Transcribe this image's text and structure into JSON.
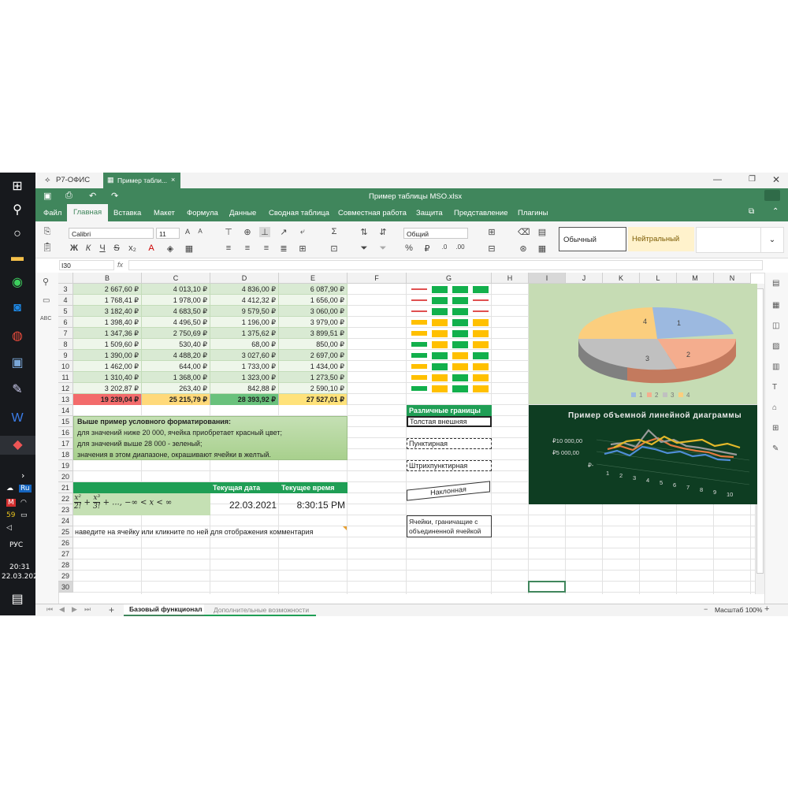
{
  "taskbar": {
    "lang": "РУС",
    "time": "20:31",
    "date": "22.03.2021",
    "tray_ru": "Ru",
    "tray_m": "M",
    "tray_59": "59"
  },
  "app": {
    "brand": "Р7-ОФИС",
    "tab_title": "Пример табли...",
    "window_title": "Пример таблицы MSO.xlsx"
  },
  "menu": [
    "Файл",
    "Главная",
    "Вставка",
    "Макет",
    "Формула",
    "Данные",
    "Сводная таблица",
    "Совместная работа",
    "Защита",
    "Представление",
    "Плагины"
  ],
  "toolbar": {
    "font": "Calibri",
    "size": "11",
    "format": "Общий",
    "style_normal": "Обычный",
    "style_neutral": "Нейтральный",
    "bold": "Ж",
    "italic": "К",
    "underline": "Ч",
    "strike": "S"
  },
  "formula": {
    "cell_ref": "I30",
    "fx": "fx"
  },
  "columns": [
    "B",
    "C",
    "D",
    "E",
    "F",
    "G",
    "H",
    "I",
    "J",
    "K",
    "L",
    "M",
    "N"
  ],
  "rows": [
    "3",
    "4",
    "5",
    "6",
    "7",
    "8",
    "9",
    "10",
    "11",
    "12",
    "13",
    "14",
    "15",
    "16",
    "17",
    "18",
    "19",
    "20",
    "21",
    "22",
    "23",
    "24",
    "25",
    "26",
    "27",
    "28",
    "29",
    "30"
  ],
  "table": [
    [
      "2 667,60 ₽",
      "4 013,10 ₽",
      "4 836,00 ₽",
      "6 087,90 ₽"
    ],
    [
      "1 768,41 ₽",
      "1 978,00 ₽",
      "4 412,32 ₽",
      "1 656,00 ₽"
    ],
    [
      "3 182,40 ₽",
      "4 683,50 ₽",
      "9 579,50 ₽",
      "3 060,00 ₽"
    ],
    [
      "1 398,40 ₽",
      "4 496,50 ₽",
      "1 196,00 ₽",
      "3 979,00 ₽"
    ],
    [
      "1 347,36 ₽",
      "2 750,69 ₽",
      "1 375,62 ₽",
      "3 899,51 ₽"
    ],
    [
      "1 509,60 ₽",
      "530,40 ₽",
      "68,00 ₽",
      "850,00 ₽"
    ],
    [
      "1 390,00 ₽",
      "4 488,20 ₽",
      "3 027,60 ₽",
      "2 697,00 ₽"
    ],
    [
      "1 462,00 ₽",
      "644,00 ₽",
      "1 733,00 ₽",
      "1 434,00 ₽"
    ],
    [
      "1 310,40 ₽",
      "1 368,00 ₽",
      "1 323,00 ₽",
      "1 273,50 ₽"
    ],
    [
      "3 202,87 ₽",
      "263,40 ₽",
      "842,88 ₽",
      "2 590,10 ₽"
    ]
  ],
  "totals": [
    "19 239,04 ₽",
    "25 215,79 ₽",
    "28 393,92 ₽",
    "27 527,01 ₽"
  ],
  "note": {
    "title": "Выше пример условного форматирования:",
    "l1": "для значений ниже 20 000, ячейка приобретает красный цвет;",
    "l2": "для значений выше 28 000 - зеленый;",
    "l3": "значения в этом диапазоне, окрашивают ячейки в желтый."
  },
  "date_header": "Текущая дата",
  "time_header": "Текущее время",
  "date_value": "22.03.2021",
  "time_value": "8:30:15 PM",
  "formula_text": "+ ..., −∞ < x < ∞",
  "comment_hint": "наведите на ячейку или кликните по ней для отображения комментария",
  "borders": {
    "title": "Различные границы",
    "thick": "Толстая внешняя",
    "dotted": "Пунктирная",
    "dashdot": "Штрихпунктирная",
    "slanted": "Наклонная",
    "merged": "Ячейки, граничащие с объединенной ячейкой"
  },
  "pie_chart": {
    "labels": [
      "1",
      "2",
      "3",
      "4"
    ],
    "legend": [
      "1",
      "2",
      "3",
      "4"
    ]
  },
  "line_chart": {
    "title": "Пример объемной линейной диаграммы",
    "yticks": [
      "₽10 000,00",
      "₽5 000,00",
      "₽-"
    ],
    "xticks": [
      "1",
      "2",
      "3",
      "4",
      "5",
      "6",
      "7",
      "8",
      "9",
      "10"
    ]
  },
  "sheets": [
    "Базовый функционал",
    "Дополнительные возможности"
  ],
  "zoom": "Масштаб 100%",
  "colors": {
    "accent": "#40865c",
    "header_green": "#1f9e55",
    "band": "#d9ead3"
  }
}
